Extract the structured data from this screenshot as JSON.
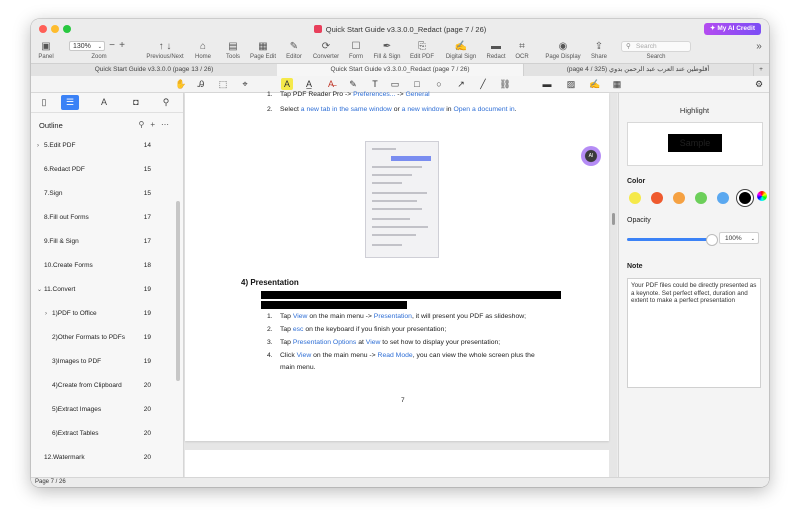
{
  "window": {
    "title": "Quick Start Guide v3.3.0.0_Redact (page 7 / 26)",
    "ai_credit": "My AI Credit",
    "colors": {
      "close": "#ff5f57",
      "minimize": "#febc2e",
      "maximize": "#28c840",
      "accent": "#3b82f6"
    }
  },
  "toolbar": {
    "panel": "Panel",
    "zoom_value": "130%",
    "zoom_label": "Zoom",
    "prevnext": "Previous/Next",
    "items": [
      {
        "label": "Home",
        "icon": "home-icon"
      },
      {
        "label": "Tools",
        "icon": "toolbox-icon"
      },
      {
        "label": "Page Edit",
        "icon": "grid-icon"
      },
      {
        "label": "Editor",
        "icon": "edit-icon"
      },
      {
        "label": "Converter",
        "icon": "convert-icon"
      },
      {
        "label": "Form",
        "icon": "form-icon"
      },
      {
        "label": "Fill & Sign",
        "icon": "pen-icon"
      },
      {
        "label": "Edit PDF",
        "icon": "pdf-edit-icon"
      },
      {
        "label": "Digital Sign",
        "icon": "signature-icon"
      },
      {
        "label": "Redact",
        "icon": "redact-icon"
      },
      {
        "label": "OCR",
        "icon": "ocr-icon"
      },
      {
        "label": "Page Display",
        "icon": "eye-icon"
      },
      {
        "label": "Share",
        "icon": "share-icon"
      }
    ],
    "search_placeholder": "Search",
    "search_label": "Search"
  },
  "tabs": [
    {
      "label": "Quick Start Guide v3.3.0.0 (page 13 / 26)"
    },
    {
      "label": "Quick Start Guide v3.3.0.0_Redact (page 7 / 26)"
    },
    {
      "label": "(page 4 / 325) أقلوطين عند العرب عبد الرحمن بدوي"
    }
  ],
  "sidebar": {
    "heading": "Outline",
    "items": [
      {
        "label": "5.Edit PDF",
        "page": "14"
      },
      {
        "label": "6.Redact PDF",
        "page": "15"
      },
      {
        "label": "7.Sign",
        "page": "15"
      },
      {
        "label": "8.Fill out Forms",
        "page": "17"
      },
      {
        "label": "9.Fill & Sign",
        "page": "17"
      },
      {
        "label": "10.Create Forms",
        "page": "18"
      },
      {
        "label": "11.Convert",
        "page": "19"
      },
      {
        "label": "1)PDF to Office",
        "page": "19"
      },
      {
        "label": "2)Other Formats to PDFs",
        "page": "19"
      },
      {
        "label": "3)Images to PDF",
        "page": "19"
      },
      {
        "label": "4)Create from Clipboard",
        "page": "20"
      },
      {
        "label": "5)Extract Images",
        "page": "20"
      },
      {
        "label": "6)Extract Tables",
        "page": "20"
      },
      {
        "label": "12.Watermark",
        "page": "20"
      }
    ]
  },
  "document": {
    "top_item_n": "1.",
    "top_item_a": "Tap PDF Reader Pro -> ",
    "top_item_b": "Preferences...",
    "top_item_c": " -> ",
    "top_item_d": "General",
    "item2_n": "2.",
    "item2_a": "Select ",
    "item2_b": "a new tab in the same window",
    "item2_c": " or ",
    "item2_d": "a new window",
    "item2_e": " in ",
    "item2_f": "Open a document in",
    "item2_g": ".",
    "section_heading": "4)   Presentation",
    "steps": [
      {
        "n": "1.",
        "a": "Tap ",
        "b": "View",
        "c": " on the main menu -> ",
        "d": "Presentation",
        "e": ", it will present you PDF as slideshow;"
      },
      {
        "n": "2.",
        "a": "Tap ",
        "b": "esc",
        "c": " on the keyboard if you finish your presentation;"
      },
      {
        "n": "3.",
        "a": "Tap ",
        "b": "Presentation Options",
        "c": " at ",
        "d": "View",
        "e": " to set how to display your presentation;"
      },
      {
        "n": "4.",
        "a": "Click ",
        "b": "View",
        "c": " on the main menu -> ",
        "d": "Read Mode",
        "e": ", you can view the whole screen plus the"
      }
    ],
    "step4_cont": "main menu.",
    "page_number": "7",
    "ai_badge": "AI"
  },
  "right_panel": {
    "title": "Highlight",
    "preview_text": "Sample",
    "color_label": "Color",
    "swatches": [
      "#f5e94a",
      "#ef5a2e",
      "#f5a142",
      "#6ccf5a",
      "#5aa8f0",
      "#000000"
    ],
    "opacity_label": "Opacity",
    "opacity_value": "100%",
    "opacity_fraction": 1.0,
    "note_label": "Note",
    "note_text": "Your PDF files could be directly presented as a keynote. Set perfect effect, duration and extent to make a perfect presentation"
  },
  "status": {
    "page": "Page 7 / 26"
  }
}
